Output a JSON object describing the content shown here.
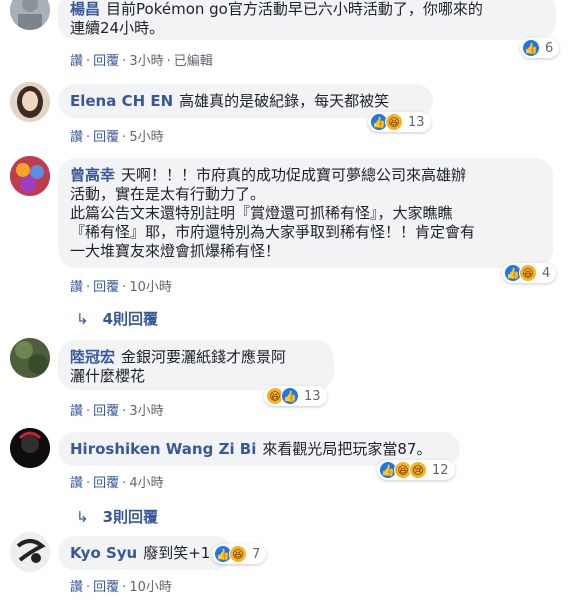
{
  "actions": {
    "like": "讚",
    "reply": "回覆",
    "sep": "·",
    "edited": "已編輯"
  },
  "comments": [
    {
      "name": "楊昌",
      "lines": [
        "目前Pokémon go官方活動早已六小時活動了，你哪來的",
        "連續24小時。"
      ],
      "time": "3小時",
      "reactions": [
        "like-icon"
      ],
      "count": "6"
    },
    {
      "name": "Elena CH EN",
      "lines": [
        "高雄真的是破紀錄，每天都被笑"
      ],
      "time": "5小時",
      "reactions": [
        "like-icon",
        "haha-icon"
      ],
      "count": "13"
    },
    {
      "name": "曾高幸",
      "lines": [
        "天啊！！！市府真的成功促成寶可夢總公司來高雄辦",
        "活動，實在是太有行動力了。",
        "此篇公告文末還特別註明『賞燈還可抓稀有怪』，大家瞧瞧",
        "『稀有怪』耶，市府還特別為大家爭取到稀有怪！！肯定會有",
        "一大堆寶友來燈會抓爆稀有怪！"
      ],
      "time": "10小時",
      "reactions": [
        "like-icon",
        "haha-icon"
      ],
      "count": "4",
      "replies_label": "4則回覆"
    },
    {
      "name": "陸冠宏",
      "lines": [
        "金銀河要灑紙錢才應景阿",
        "灑什麼櫻花"
      ],
      "time": "3小時",
      "reactions": [
        "haha-icon",
        "like-icon"
      ],
      "count": "13"
    },
    {
      "name": "Hiroshiken Wang Zi Bi",
      "lines": [
        "來看觀光局把玩家當87。"
      ],
      "time": "4小時",
      "reactions": [
        "like-icon",
        "haha-icon",
        "sad-icon"
      ],
      "count": "12",
      "replies_label": "3則回覆"
    },
    {
      "name": "Kyo Syu",
      "lines": [
        "廢到笑+1"
      ],
      "time": "10小時",
      "reactions": [
        "like-icon",
        "haha-icon"
      ],
      "count": "7"
    }
  ]
}
